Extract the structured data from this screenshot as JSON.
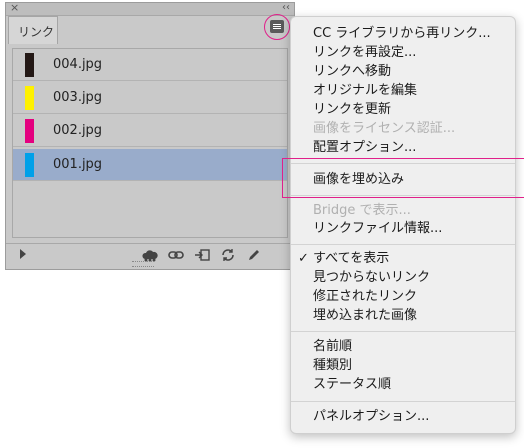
{
  "panel": {
    "tab_label": "リンク",
    "close_glyph": "×",
    "collapse_glyph": "‹‹",
    "files": [
      {
        "name": "004.jpg",
        "color": "#231815",
        "selected": false
      },
      {
        "name": "003.jpg",
        "color": "#fff100",
        "selected": false
      },
      {
        "name": "002.jpg",
        "color": "#e4007f",
        "selected": false
      },
      {
        "name": "001.jpg",
        "color": "#00a0e9",
        "selected": true
      }
    ],
    "bottom_tools": [
      "cc-library-icon",
      "relink-chain-icon",
      "goto-link-icon",
      "update-link-icon",
      "edit-original-icon"
    ]
  },
  "menu": {
    "items": [
      "CC ライブラリから再リンク...",
      "リンクを再設定...",
      "リンクへ移動",
      "オリジナルを編集",
      "リンクを更新",
      "画像をライセンス認証...",
      "配置オプション...",
      "画像を埋め込み",
      "Bridge で表示...",
      "リンクファイル情報...",
      "すべてを表示",
      "見つからないリンク",
      "修正されたリンク",
      "埋め込まれた画像",
      "名前順",
      "種類別",
      "ステータス順",
      "パネルオプション..."
    ],
    "check_glyph": "✓"
  },
  "colors": {
    "highlight": "#e0208a",
    "selection": "#99accb"
  }
}
